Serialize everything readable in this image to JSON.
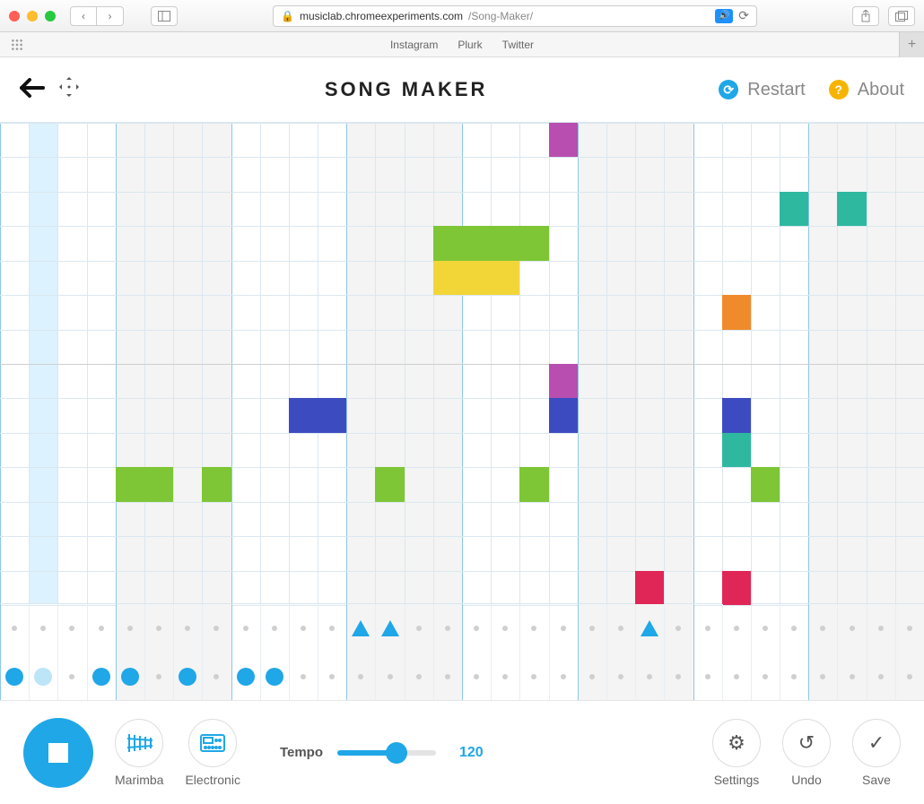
{
  "browser": {
    "url_host": "musiclab.chromeexperiments.com",
    "url_path": "/Song-Maker/",
    "bookmarks": [
      "Instagram",
      "Plurk",
      "Twitter"
    ]
  },
  "header": {
    "title": "SONG MAKER",
    "restart_label": "Restart",
    "about_label": "About"
  },
  "grid": {
    "cols": 32,
    "rows": 14,
    "playhead_col": 1,
    "beat_groups_shaded": [
      [
        4,
        7
      ],
      [
        12,
        15
      ],
      [
        20,
        23
      ],
      [
        28,
        31
      ]
    ],
    "colors": {
      "magenta": "#b84fb0",
      "green": "#7ec636",
      "yellow": "#f2d638",
      "teal": "#2fb8a0",
      "orange": "#f08b2c",
      "indigo": "#3c4cc0",
      "crimson": "#e02656"
    },
    "notes": [
      {
        "row": 0,
        "col": 19,
        "color": "magenta"
      },
      {
        "row": 2,
        "col": 27,
        "color": "teal"
      },
      {
        "row": 2,
        "col": 29,
        "color": "teal"
      },
      {
        "row": 3,
        "col": 15,
        "color": "green"
      },
      {
        "row": 3,
        "col": 16,
        "color": "green"
      },
      {
        "row": 3,
        "col": 17,
        "color": "green"
      },
      {
        "row": 3,
        "col": 18,
        "color": "green"
      },
      {
        "row": 4,
        "col": 15,
        "color": "yellow"
      },
      {
        "row": 4,
        "col": 16,
        "color": "yellow"
      },
      {
        "row": 4,
        "col": 17,
        "color": "yellow"
      },
      {
        "row": 5,
        "col": 25,
        "color": "orange"
      },
      {
        "row": 7,
        "col": 19,
        "color": "magenta"
      },
      {
        "row": 8,
        "col": 10,
        "color": "indigo"
      },
      {
        "row": 8,
        "col": 11,
        "color": "indigo"
      },
      {
        "row": 8,
        "col": 19,
        "color": "indigo"
      },
      {
        "row": 8,
        "col": 25,
        "color": "indigo"
      },
      {
        "row": 9,
        "col": 25,
        "color": "teal"
      },
      {
        "row": 10,
        "col": 4,
        "color": "green"
      },
      {
        "row": 10,
        "col": 5,
        "color": "green"
      },
      {
        "row": 10,
        "col": 7,
        "color": "green"
      },
      {
        "row": 10,
        "col": 13,
        "color": "green"
      },
      {
        "row": 10,
        "col": 18,
        "color": "green"
      },
      {
        "row": 10,
        "col": 26,
        "color": "green"
      },
      {
        "row": 13,
        "col": 22,
        "color": "crimson"
      },
      {
        "row": 13,
        "col": 25,
        "color": "crimson"
      }
    ]
  },
  "percussion": {
    "rows": 2,
    "cells_row0": [
      {
        "col": 12,
        "type": "tri"
      },
      {
        "col": 13,
        "type": "tri"
      },
      {
        "col": 22,
        "type": "tri"
      }
    ],
    "cells_row1": [
      {
        "col": 0,
        "type": "big"
      },
      {
        "col": 1,
        "type": "big-faded"
      },
      {
        "col": 3,
        "type": "big"
      },
      {
        "col": 4,
        "type": "big"
      },
      {
        "col": 6,
        "type": "big"
      },
      {
        "col": 8,
        "type": "big"
      },
      {
        "col": 9,
        "type": "big"
      }
    ]
  },
  "toolbar": {
    "melody_instrument": "Marimba",
    "rhythm_instrument": "Electronic",
    "tempo_label": "Tempo",
    "tempo_value": "120",
    "tempo_fill_pct": 60,
    "settings_label": "Settings",
    "undo_label": "Undo",
    "save_label": "Save"
  }
}
